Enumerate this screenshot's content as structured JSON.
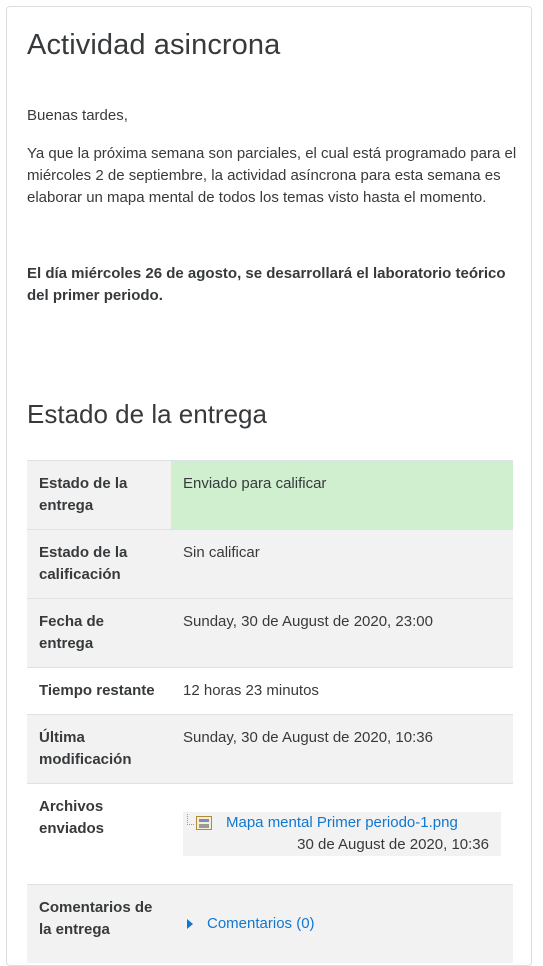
{
  "activity": {
    "title": "Actividad asincrona",
    "greeting": "Buenas tardes,",
    "paragraph": "Ya que la próxima semana son parciales, el cual está programado para el miércoles 2 de septiembre, la actividad asíncrona para esta semana es elaborar un mapa mental de todos los temas visto hasta el momento.",
    "bold_note": "El día miércoles 26 de agosto, se desarrollará el laboratorio teórico del primer periodo."
  },
  "submission": {
    "title": "Estado de la entrega",
    "rows": [
      {
        "label": "Estado de la entrega",
        "value": "Enviado para calificar"
      },
      {
        "label": "Estado de la calificación",
        "value": "Sin calificar"
      },
      {
        "label": "Fecha de entrega",
        "value": "Sunday, 30 de August de 2020, 23:00"
      },
      {
        "label": "Tiempo restante",
        "value": "12 horas 23 minutos"
      },
      {
        "label": "Última modificación",
        "value": "Sunday, 30 de August de 2020, 10:36"
      },
      {
        "label": "Archivos enviados",
        "file_name": "Mapa mental Primer periodo-1.png",
        "file_date": "30 de August de 2020, 10:36"
      },
      {
        "label": "Comentarios de la entrega",
        "comments_link": "Comentarios (0)"
      }
    ]
  },
  "icons": {
    "file": "image-file-icon",
    "comments": "caret-right-icon"
  },
  "colors": {
    "link": "#1177d1",
    "submitted_bg": "#cfefcf",
    "stripe_bg": "#f2f2f2"
  }
}
